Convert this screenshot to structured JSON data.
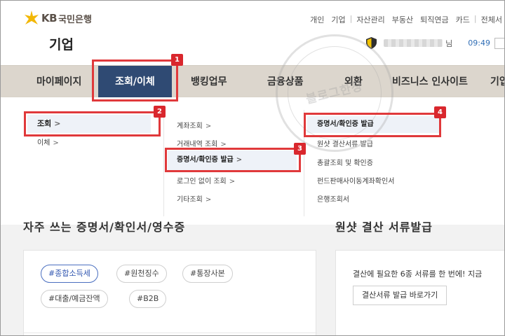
{
  "header": {
    "logo_text": "KB",
    "logo_name": "국민은행",
    "corp_title": "기업",
    "util_nav": [
      "개인",
      "기업",
      "자산관리",
      "부동산",
      "퇴직연금",
      "카드",
      "전체서"
    ],
    "user_suffix": "님",
    "time": "09:49"
  },
  "gnb": {
    "items": [
      "마이페이지",
      "조회/이체",
      "뱅킹업무",
      "금융상품",
      "외환",
      "비즈니스 인사이트",
      "기업"
    ]
  },
  "dropdown": {
    "col1": [
      "조회",
      "이체"
    ],
    "col2": [
      "계좌조회",
      "거래내역 조회",
      "증명서/확인증 발급",
      "로그인 없이 조회",
      "기타조회"
    ],
    "col3": [
      "증명서/확인증 발급",
      "원샷 결산서류 발급",
      "총괄조회 및 확인증",
      "펀드판매사이동계좌확인서",
      "은행조회서"
    ],
    "arrow": ">"
  },
  "badges": [
    "1",
    "2",
    "3",
    "4"
  ],
  "lower": {
    "left_title": "자주 쓰는 증명서/확인서/영수증",
    "right_title": "원샷 결산 서류발급",
    "tags": [
      "#종합소득세",
      "#원천징수",
      "#통장사본",
      "#대출/예금잔액",
      "#B2B"
    ],
    "right_text": "결산에 필요한 6종 서류를 한 번에! 지금",
    "right_button": "결산서류 발급 바로가기"
  },
  "watermark": {
    "text": "블로그한장"
  },
  "colors": {
    "gnb_bg": "#dcd6cd",
    "gnb_active": "#2f4a73",
    "annotation": "#e0393b",
    "logo_gold": "#f2b705"
  }
}
